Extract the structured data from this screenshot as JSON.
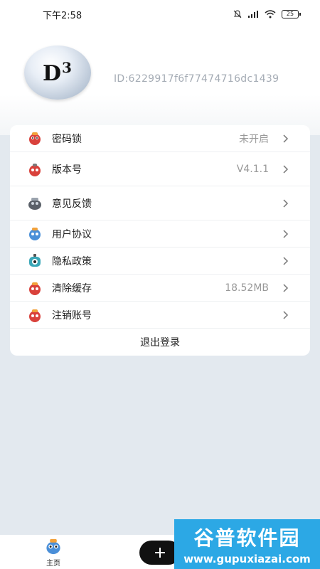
{
  "status_bar": {
    "time": "下午2:58",
    "battery": "25"
  },
  "profile": {
    "avatar_text": "D",
    "avatar_sup": "3",
    "user_id": "ID:6229917f6f77474716dc1439"
  },
  "menu": {
    "items": [
      {
        "label": "密码锁",
        "value": "未开启",
        "icon": "robot-red-icon"
      },
      {
        "label": "版本号",
        "value": "V4.1.1",
        "icon": "robot-red-icon"
      },
      {
        "label": "意见反馈",
        "value": "",
        "icon": "robot-gray-icon"
      },
      {
        "label": "用户协议",
        "value": "",
        "icon": "robot-blue-icon"
      },
      {
        "label": "隐私政策",
        "value": "",
        "icon": "robot-teal-icon"
      },
      {
        "label": "清除缓存",
        "value": "18.52MB",
        "icon": "robot-red-icon"
      },
      {
        "label": "注销账号",
        "value": "",
        "icon": "robot-red-icon"
      }
    ],
    "logout_label": "退出登录"
  },
  "bottom_nav": {
    "home_label": "主页",
    "add_icon": "plus-icon"
  },
  "watermark": {
    "title": "谷普软件园",
    "url": "www.gupuxiazai.com"
  },
  "colors": {
    "background": "#e3e9ef",
    "card": "#ffffff",
    "add_button": "#111111",
    "watermark": "#2ca8e5"
  }
}
